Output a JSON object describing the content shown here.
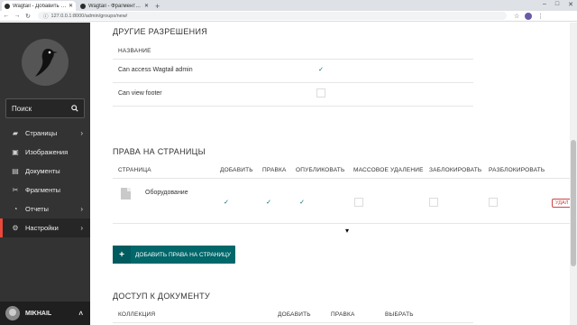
{
  "browser": {
    "tabs": [
      {
        "label": "Wagtail - Добавить груп…",
        "active": true
      },
      {
        "label": "Wagtail - Фрагменты Фу…",
        "active": false
      }
    ],
    "url": "127.0.0.1:8000/admin/groups/new/",
    "new_tab": "+"
  },
  "sidebar": {
    "search_placeholder": "Поиск",
    "items": [
      {
        "label": "Страницы",
        "icon": "folder-icon",
        "has_submenu": true
      },
      {
        "label": "Изображения",
        "icon": "image-icon",
        "has_submenu": false
      },
      {
        "label": "Документы",
        "icon": "document-icon",
        "has_submenu": false
      },
      {
        "label": "Фрагменты",
        "icon": "snippet-icon",
        "has_submenu": false
      },
      {
        "label": "Отчеты",
        "icon": "reports-icon",
        "has_submenu": true
      },
      {
        "label": "Настройки",
        "icon": "cog-icon",
        "has_submenu": true,
        "active": true
      }
    ],
    "user": "MIKHAIL"
  },
  "other_permissions": {
    "title": "ДРУГИЕ РАЗРЕШЕНИЯ",
    "column": "НАЗВАНИЕ",
    "rows": [
      {
        "label": "Can access Wagtail admin",
        "checked": true
      },
      {
        "label": "Can view footer",
        "checked": false
      }
    ]
  },
  "page_permissions": {
    "title": "ПРАВА НА СТРАНИЦЫ",
    "columns": [
      "СТРАНИЦА",
      "ДОБАВИТЬ",
      "ПРАВКА",
      "ОПУБЛИКОВАТЬ",
      "МАССОВОЕ УДАЛЕНИЕ",
      "ЗАБЛОКИРОВАТЬ",
      "РАЗБЛОКИРОВАТЬ"
    ],
    "rows": [
      {
        "page": "Оборудование",
        "checks": [
          true,
          true,
          true,
          false,
          false,
          false
        ]
      }
    ],
    "delete_label": "УДАЛ",
    "add_button": "ДОБАВИТЬ ПРАВА НА СТРАНИЦУ"
  },
  "document_access": {
    "title": "ДОСТУП К ДОКУМЕНТУ",
    "columns": [
      "КОЛЛЕКЦИЯ",
      "ДОБАВИТЬ",
      "ПРАВКА",
      "ВЫБРАТЬ"
    ]
  }
}
